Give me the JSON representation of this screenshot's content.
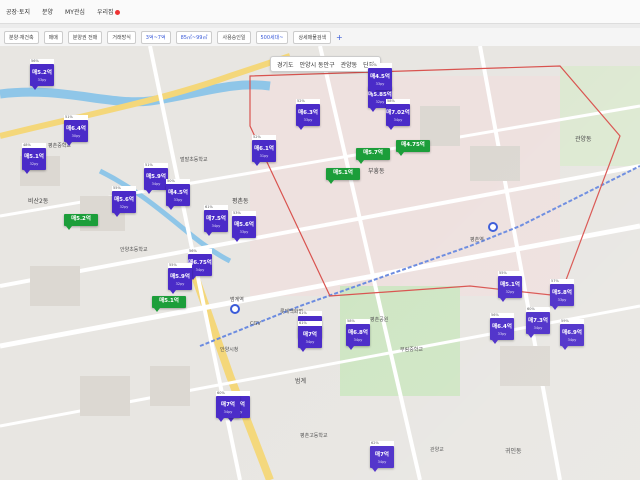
{
  "topnav": {
    "items": [
      "공장·토지",
      "분양",
      "MY관심",
      "우리집"
    ]
  },
  "filters": [
    {
      "label": "분양·재건축",
      "accent": false
    },
    {
      "label": "매매",
      "accent": false
    },
    {
      "label": "분양권 전매",
      "accent": false
    },
    {
      "label": "거래방식",
      "accent": false
    },
    {
      "label": "3억~7억",
      "accent": true
    },
    {
      "label": "85㎡~99㎡",
      "accent": true
    },
    {
      "label": "사용승인일",
      "accent": false
    },
    {
      "label": "500세대~",
      "accent": true
    },
    {
      "label": "상세매물검색",
      "accent": false
    }
  ],
  "breadcrumb": {
    "province": "경기도",
    "city": "안양시 동안구",
    "dong": "관양동",
    "mode": "단지"
  },
  "map_labels": {
    "districts": [
      "비산2동",
      "부흥동",
      "평촌동",
      "관양동",
      "귀인동",
      "범계"
    ],
    "places": [
      "평촌중학교",
      "평촌고등학교",
      "안양시청",
      "평촌역",
      "범계역",
      "CGV",
      "롯데백화점",
      "안양초등학교",
      "부림중학교",
      "벌말초등학교",
      "평촌공원",
      "관양교"
    ]
  },
  "pins": [
    {
      "price": "매5.2억",
      "tag": "56%",
      "sub": "33py",
      "color": "purple"
    },
    {
      "price": "매6.4억",
      "tag": "51%",
      "sub": "30py",
      "color": "purple"
    },
    {
      "price": "매5.1억",
      "tag": "48%",
      "sub": "32py",
      "color": "purple"
    },
    {
      "price": "매5.9억",
      "tag": "51%",
      "sub": "34py",
      "color": "purple"
    },
    {
      "price": "매5.6억",
      "tag": "55%",
      "sub": "32py",
      "color": "purple"
    },
    {
      "price": "매4.5억",
      "tag": "50%",
      "sub": "33py",
      "color": "purple"
    },
    {
      "price": "매6.1억",
      "tag": "52%",
      "sub": "31py",
      "color": "purple"
    },
    {
      "price": "매7.5억",
      "tag": "61%",
      "sub": "34py",
      "color": "purple"
    },
    {
      "price": "매5.6억",
      "tag": "53%",
      "sub": "33py",
      "color": "purple"
    },
    {
      "price": "매6.75억",
      "tag": "56%",
      "sub": "34py",
      "color": "purple"
    },
    {
      "price": "매5.9억",
      "tag": "55%",
      "sub": "32py",
      "color": "purple"
    },
    {
      "price": "매5.2억",
      "tag": "",
      "sub": "",
      "color": "green"
    },
    {
      "price": "매5.1억",
      "tag": "",
      "sub": "",
      "color": "green"
    },
    {
      "price": "매6.3억",
      "tag": "52%",
      "sub": "33py",
      "color": "purple"
    },
    {
      "price": "매5.85억",
      "tag": "56%",
      "sub": "32py",
      "color": "purple"
    },
    {
      "price": "매4.5억",
      "tag": "50%",
      "sub": "33py",
      "color": "purple"
    },
    {
      "price": "매7.02억",
      "tag": "58%",
      "sub": "34py",
      "color": "purple"
    },
    {
      "price": "매5.1억",
      "tag": "",
      "sub": "",
      "color": "green"
    },
    {
      "price": "매5.7억",
      "tag": "",
      "sub": "",
      "color": "green"
    },
    {
      "price": "매4.75억",
      "tag": "",
      "sub": "",
      "color": "green"
    },
    {
      "price": "매7억",
      "tag": "62%",
      "sub": "34py",
      "color": "purple"
    },
    {
      "price": "매7억",
      "tag": "61%",
      "sub": "34py",
      "color": "purple"
    },
    {
      "price": "매6.8억",
      "tag": "58%",
      "sub": "34py",
      "color": "purple"
    },
    {
      "price": "매6.4억",
      "tag": "56%",
      "sub": "33py",
      "color": "purple"
    },
    {
      "price": "매7.3억",
      "tag": "60%",
      "sub": "34py",
      "color": "purple"
    },
    {
      "price": "매6.9억",
      "tag": "59%",
      "sub": "34py",
      "color": "purple"
    },
    {
      "price": "매5.1억",
      "tag": "55%",
      "sub": "32py",
      "color": "purple"
    },
    {
      "price": "매5.8억",
      "tag": "57%",
      "sub": "33py",
      "color": "purple"
    },
    {
      "price": "매7억",
      "tag": "60%",
      "sub": "34py",
      "color": "purple"
    },
    {
      "price": "매7억",
      "tag": "61%",
      "sub": "34py",
      "color": "purple"
    },
    {
      "price": "매7억",
      "tag": "62%",
      "sub": "34py",
      "color": "purple"
    }
  ],
  "colors": {
    "pin_purple": "#4a2bc8",
    "pin_green": "#1c9e3a",
    "accent_blue": "#3a5bd9",
    "boundary_red": "#d9534f",
    "river": "#8fc6e8",
    "road_yellow": "#f4d77a"
  }
}
